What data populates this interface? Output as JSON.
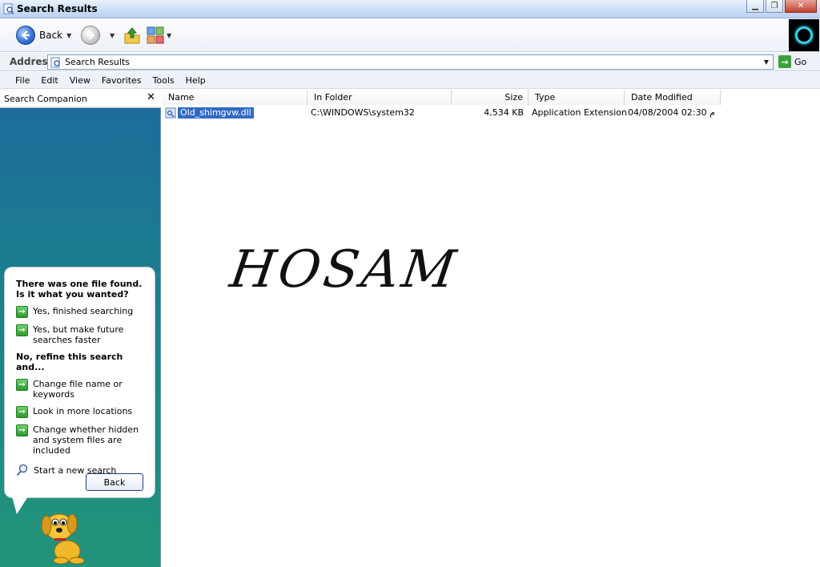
{
  "window": {
    "title": "Search Results"
  },
  "toolbar": {
    "back_label": "Back"
  },
  "address": {
    "label": "Address",
    "value": "Search Results",
    "go_label": "Go"
  },
  "menu": [
    "File",
    "Edit",
    "View",
    "Favorites",
    "Tools",
    "Help"
  ],
  "companion": {
    "title": "Search Companion",
    "found_heading": "There was one file found.  Is it what you wanted?",
    "yes_options": [
      "Yes, finished searching",
      "Yes, but make future searches faster"
    ],
    "refine_heading": "No, refine this search and...",
    "refine_options": [
      "Change file name or keywords",
      "Look in more locations",
      "Change whether hidden and system files are included"
    ],
    "new_search": "Start a new search",
    "back_button": "Back"
  },
  "results": {
    "columns": [
      "Name",
      "In Folder",
      "Size",
      "Type",
      "Date Modified"
    ],
    "rows": [
      {
        "name": "Old_shimgvw.dll",
        "folder": "C:\\WINDOWS\\system32",
        "size": "4,534 KB",
        "type": "Application Extension",
        "date": "04/08/2004 02:30 م"
      }
    ]
  },
  "watermark": "HOSAM",
  "colors": {
    "selection": "#316ac5",
    "pane_top": "#1d6a9c",
    "pane_bottom": "#23937a",
    "link_arrow": "#2d9a2d"
  },
  "icons": [
    "search-results-icon",
    "back-arrow-icon",
    "forward-arrow-icon",
    "up-folder-icon",
    "views-icon",
    "go-arrow-icon",
    "close-icon",
    "green-arrow-icon",
    "magnifier-icon",
    "dll-file-icon",
    "rover-dog-icon"
  ]
}
